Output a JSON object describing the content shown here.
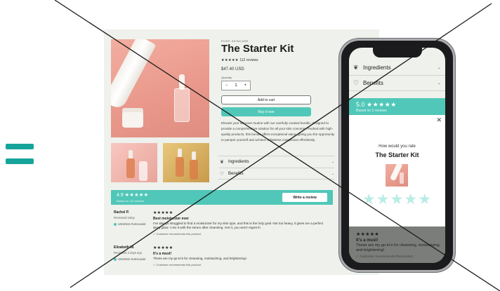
{
  "colors": {
    "accent": "#50c7b8",
    "equals": "#16a49a",
    "page_bg": "#eef1ec",
    "ink": "#1c1c1c"
  },
  "icons": {
    "ingredients": "leaf-icon",
    "benefits": "heart-icon",
    "chevron": "chevron-down-icon",
    "close": "close-icon",
    "check": "check-icon",
    "star": "star-icon"
  },
  "desktop": {
    "brand": "PURE SKINCARE",
    "title": "The Starter Kit",
    "stars": "★★★★★",
    "review_count": "112 reviews",
    "price": "$47.40 USD",
    "quantity_label": "Quantity",
    "quantity": {
      "minus": "−",
      "value": "1",
      "plus": "+"
    },
    "add_to_cart": "Add to cart",
    "buy_now": "Buy it now",
    "description": "Elevate your skincare routine with our carefully curated bundle, designed to provide a comprehensive solution for all your skin concerns. Packed with high-quality products, this bundle offers exceptional value, giving you the opportunity to pamper yourself and achieve a flawless complexion effortlessly.",
    "accordions": [
      {
        "label": "Ingredients",
        "icon": "❦"
      },
      {
        "label": "Benefits",
        "icon": "♡"
      }
    ],
    "chevron": "⌄",
    "review_summary": {
      "score": "4.9",
      "stars": "★★★★★",
      "based_on": "Based on 112 reviews",
      "write_review": "Write a review"
    },
    "reviews": [
      {
        "name": "Rachel P.",
        "when": "Reviewed today",
        "verified": "VERIFIED PURCHASE",
        "stars": "★★★★★",
        "headline": "Best moisturizer ever",
        "text": "I've always struggled to find a moisturizer for my skin type, and this is the holy grail. Not too heavy, it gives me a perfect dewy glow. I mix it with the serum after cleansing. Get it, you won't regret it!",
        "recommend": "✓ Customer recommends this product"
      },
      {
        "name": "Elizabeth W.",
        "when": "Reviewed 3 days ago",
        "verified": "VERIFIED PURCHASE",
        "stars": "★★★★★",
        "headline": "It's a must!",
        "text": "These are my go-to's for cleansing, moisturizing, and brightening!",
        "recommend": "✓ Customer recommends this product"
      }
    ]
  },
  "phone": {
    "accordions": [
      {
        "label": "Ingredients",
        "icon": "❦"
      },
      {
        "label": "Benefits",
        "icon": "♡"
      }
    ],
    "chevron": "⌄",
    "summary": {
      "score": "5.0",
      "stars": "★★★★★",
      "based_on": "Based on 2 reviews"
    },
    "modal": {
      "close": "✕",
      "question": "How would you rate",
      "title": "The Starter Kit",
      "rating_stars": "★★★★★"
    },
    "review": {
      "stars": "★★★★★",
      "headline": "It's a must!",
      "text": "These are my go-to's for cleansing, moisturizing, and brightening!",
      "recommend": "✓ Customer recommends this product"
    }
  }
}
